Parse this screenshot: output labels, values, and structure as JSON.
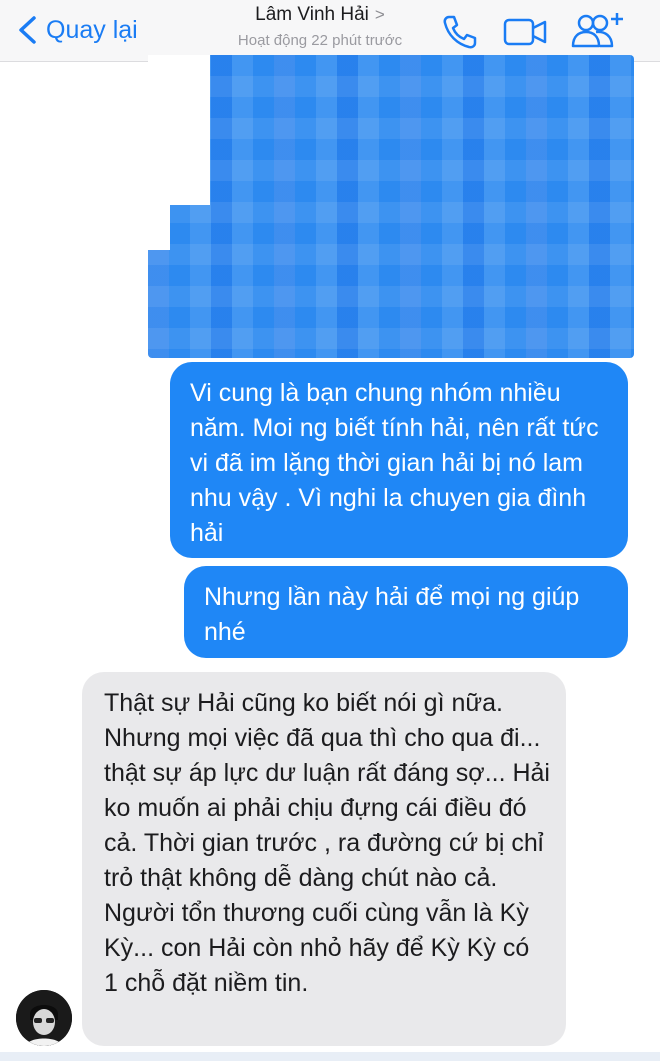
{
  "header": {
    "back_label": "Quay lại",
    "contact_name": "Lâm Vinh Hải",
    "title_chevron": ">",
    "status": "Hoạt động 22 phút trước",
    "icons": [
      "chevron-left-icon",
      "phone-icon",
      "video-camera-icon",
      "add-people-icon"
    ]
  },
  "colors": {
    "accent": "#1a7cf4",
    "sent_bubble": "#1f87f6",
    "received_bubble": "#e9e9eb"
  },
  "messages": [
    {
      "direction": "sent",
      "text": "Vi cung là bạn chung nhóm nhiều năm. Moi ng biết tính hải, nên rất tức vi đã im lặng thời gian hải bị nó lam nhu vậy . Vì nghi la chuyen gia đình hải"
    },
    {
      "direction": "sent",
      "text": "Nhưng lần này hải để mọi ng giúp nhé"
    },
    {
      "direction": "received",
      "text": "Thật sự Hải cũng ko biết nói gì nữa. Nhưng mọi việc đã qua thì cho qua đi... thật sự áp lực dư luận rất đáng sợ... Hải ko muốn ai phải chịu đựng cái điều đó cả. Thời gian trước , ra đường cứ bị chỉ trỏ thật không dễ dàng chút nào cả. Người tổn thương cuối cùng vẫn là Kỳ Kỳ... con Hải còn nhỏ hãy để Kỳ Kỳ có 1 chỗ đặt niềm tin."
    }
  ]
}
